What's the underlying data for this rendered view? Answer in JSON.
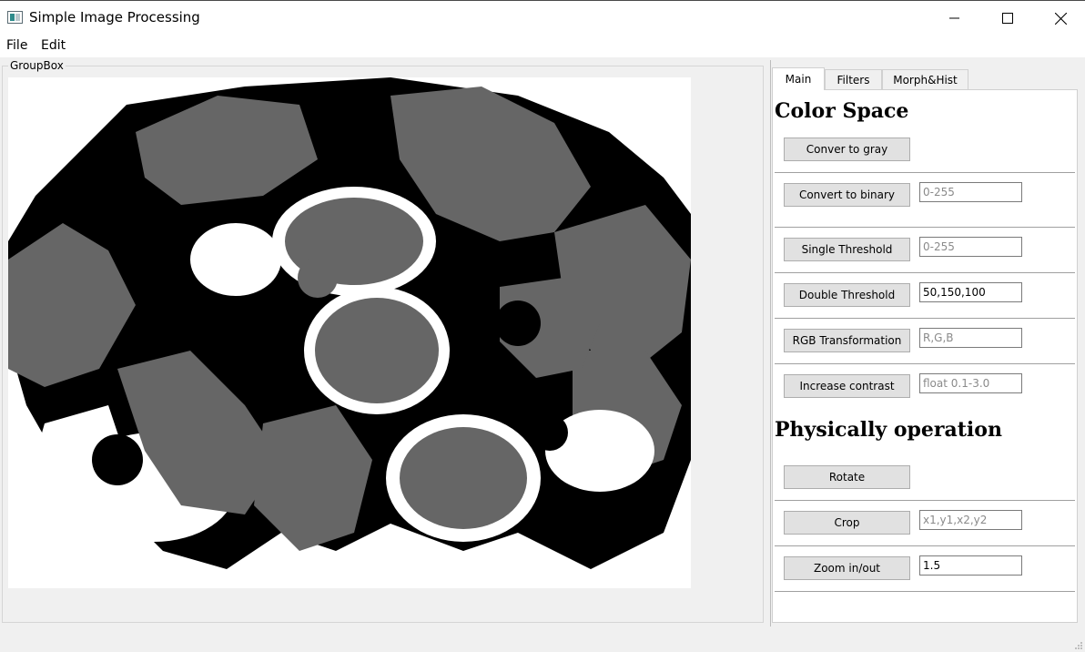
{
  "window": {
    "title": "Simple Image Processing"
  },
  "menu": {
    "file": "File",
    "edit": "Edit"
  },
  "groupbox": {
    "title": "GroupBox"
  },
  "tabs": [
    {
      "label": "Main",
      "active": true
    },
    {
      "label": "Filters",
      "active": false
    },
    {
      "label": "Morph&Hist",
      "active": false
    }
  ],
  "main": {
    "color_space_title": "Color Space",
    "physical_title": "Physically operation",
    "gray_button": "Conver to gray",
    "binary_button": "Convert to binary",
    "binary_placeholder": "0-255",
    "single_button": "Single Threshold",
    "single_placeholder": "0-255",
    "double_button": "Double Threshold",
    "double_value": "50,150,100",
    "rgb_button": "RGB Transformation",
    "rgb_placeholder": "R,G,B",
    "contrast_button": "Increase contrast",
    "contrast_placeholder": "float 0.1-3.0",
    "rotate_button": "Rotate",
    "crop_button": "Crop",
    "crop_placeholder": "x1,y1,x2,y2",
    "zoom_button": "Zoom in/out",
    "zoom_value": "1.5"
  },
  "colors": {
    "image_gray": "#666666",
    "image_black": "#000000",
    "image_white": "#ffffff"
  }
}
